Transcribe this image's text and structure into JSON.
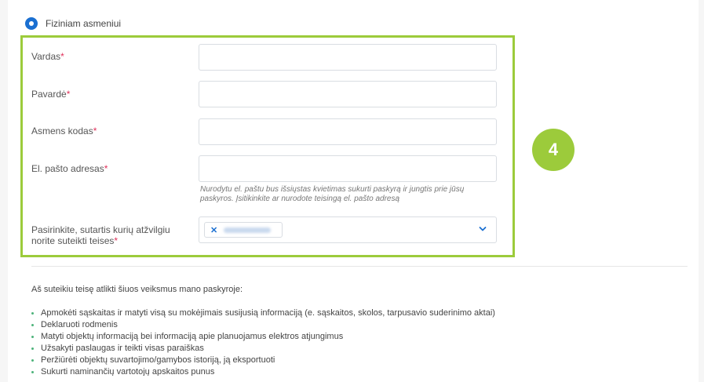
{
  "person_type": {
    "label": "Fiziniam asmeniui",
    "selected": true
  },
  "form": {
    "first_name": {
      "label": "Vardas",
      "required_mark": "*",
      "value": ""
    },
    "last_name": {
      "label": "Pavardė",
      "required_mark": "*",
      "value": ""
    },
    "personal_code": {
      "label": "Asmens kodas",
      "required_mark": "*",
      "value": ""
    },
    "email": {
      "label": "El. pašto adresas",
      "required_mark": "*",
      "value": "",
      "hint": "Nurodytu el. paštu bus išsiųstas kvietimas sukurti paskyrą ir jungtis prie jūsų paskyros. Įsitikinkite ar nurodote teisingą el. pašto adresą"
    },
    "contracts": {
      "label": "Pasirinkite, sutartis kurių atžvilgiu norite suteikti teises",
      "required_mark": "*",
      "chip_remove_icon": "close-icon",
      "dropdown_icon": "chevron-down-icon"
    }
  },
  "step_badge": "4",
  "permissions": {
    "intro": "Aš suteikiu teisę atlikti šiuos veiksmus mano paskyroje:",
    "items": [
      "Apmokėti sąskaitas ir matyti visą su mokėjimais susijusią informaciją (e. sąskaitos, skolos, tarpusavio suderinimo aktai)",
      "Deklaruoti rodmenis",
      "Matyti objektų informaciją bei informaciją apie planuojamus elektros atjungimus",
      "Užsakyti paslaugas ir teikti visas paraiškas",
      "Peržiūrėti objektų suvartojimo/gamybos istoriją, ją eksportuoti",
      "Sukurti naminančių vartotojų apskaitos punus"
    ]
  },
  "colors": {
    "accent_green": "#9ccb3b",
    "radio_blue": "#1a6fd1",
    "required_red": "#e0305a",
    "bullet_green": "#4db37a"
  }
}
